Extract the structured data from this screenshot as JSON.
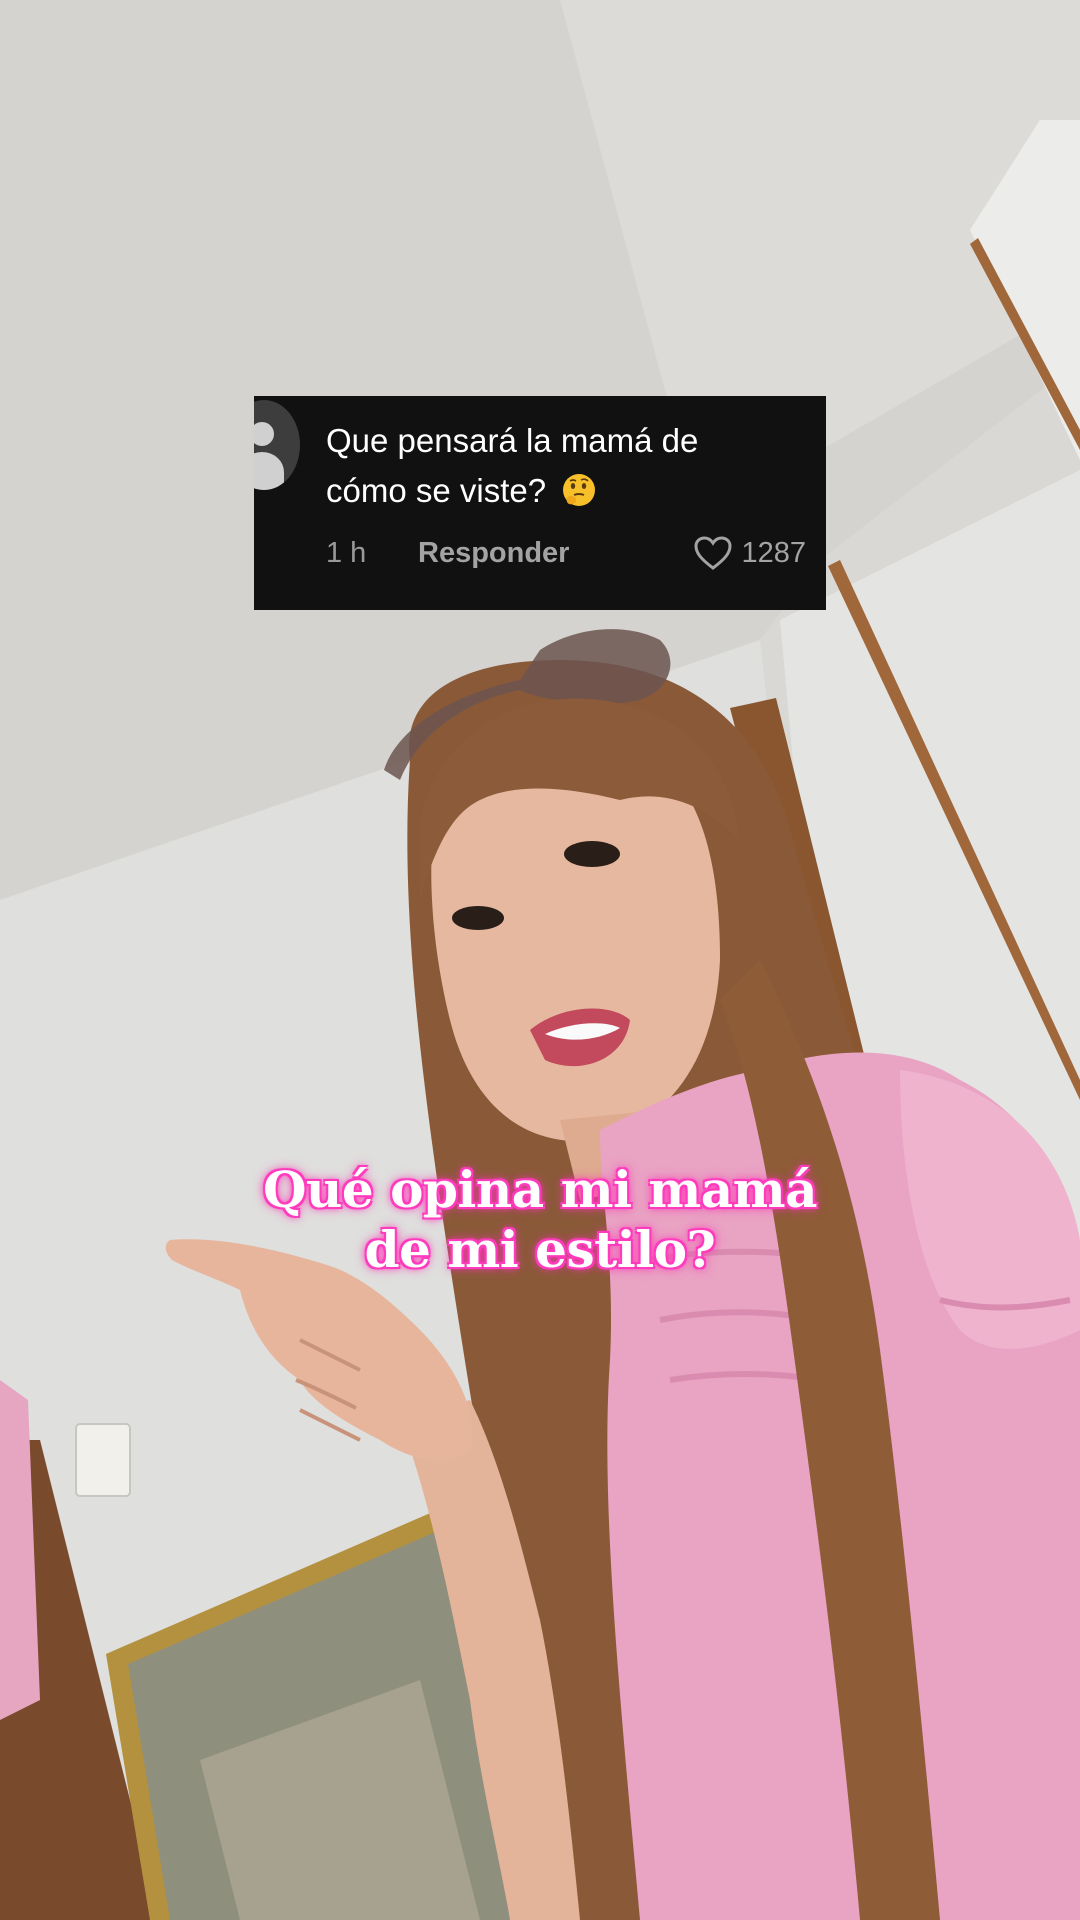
{
  "comment": {
    "text_line1": "Que pensará la mamá de",
    "text_line2": "cómo se viste?",
    "emoji": "thinking-face-emoji",
    "time": "1 h",
    "reply_label": "Responder",
    "like_count": "1287"
  },
  "caption": {
    "line1": "Qué opina mi mamá",
    "line2": "de mi estilo?"
  },
  "colors": {
    "card_bg": "#111111",
    "caption_glow": "#ff3fbf",
    "shirt_pink": "#e9a3c3",
    "hair": "#8a5a38"
  }
}
